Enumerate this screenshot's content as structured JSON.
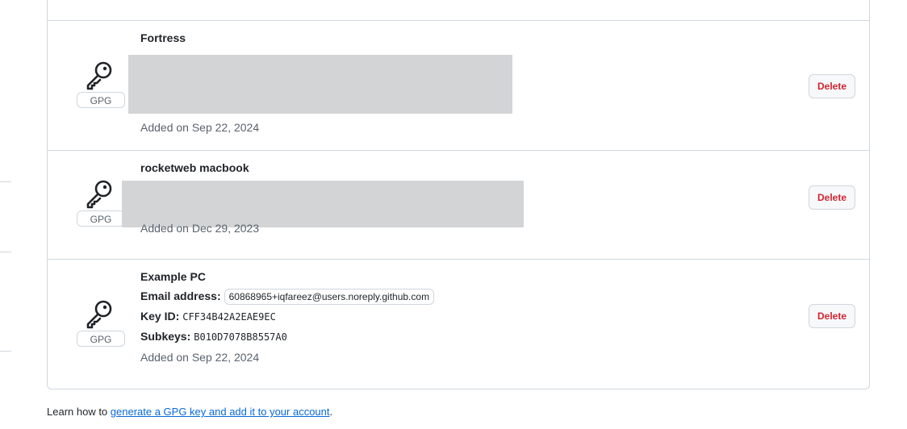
{
  "keys": [
    {
      "title": "Fortress",
      "badge": "GPG",
      "added": "Added on Sep 22, 2024",
      "delete_label": "Delete"
    },
    {
      "title": "rocketweb macbook",
      "badge": "GPG",
      "added": "Added on Dec 29, 2023",
      "delete_label": "Delete"
    },
    {
      "title": "Example PC",
      "badge": "GPG",
      "email_label": "Email address:",
      "email_value": "60868965+iqfareez@users.noreply.github.com",
      "keyid_label": "Key ID:",
      "keyid_value": "CFF34B42A2EAE9EC",
      "subkeys_label": "Subkeys:",
      "subkeys_value": "B010D7078B8557A0",
      "added": "Added on Sep 22, 2024",
      "delete_label": "Delete"
    }
  ],
  "footer": {
    "prefix": "Learn how to ",
    "link_text": "generate a GPG key and add it to your account",
    "suffix": "."
  },
  "colors": {
    "danger": "#d1242f",
    "link": "#0969da",
    "border": "#d0d7de",
    "muted": "#59636e"
  },
  "icons": {
    "key": "key-icon"
  }
}
